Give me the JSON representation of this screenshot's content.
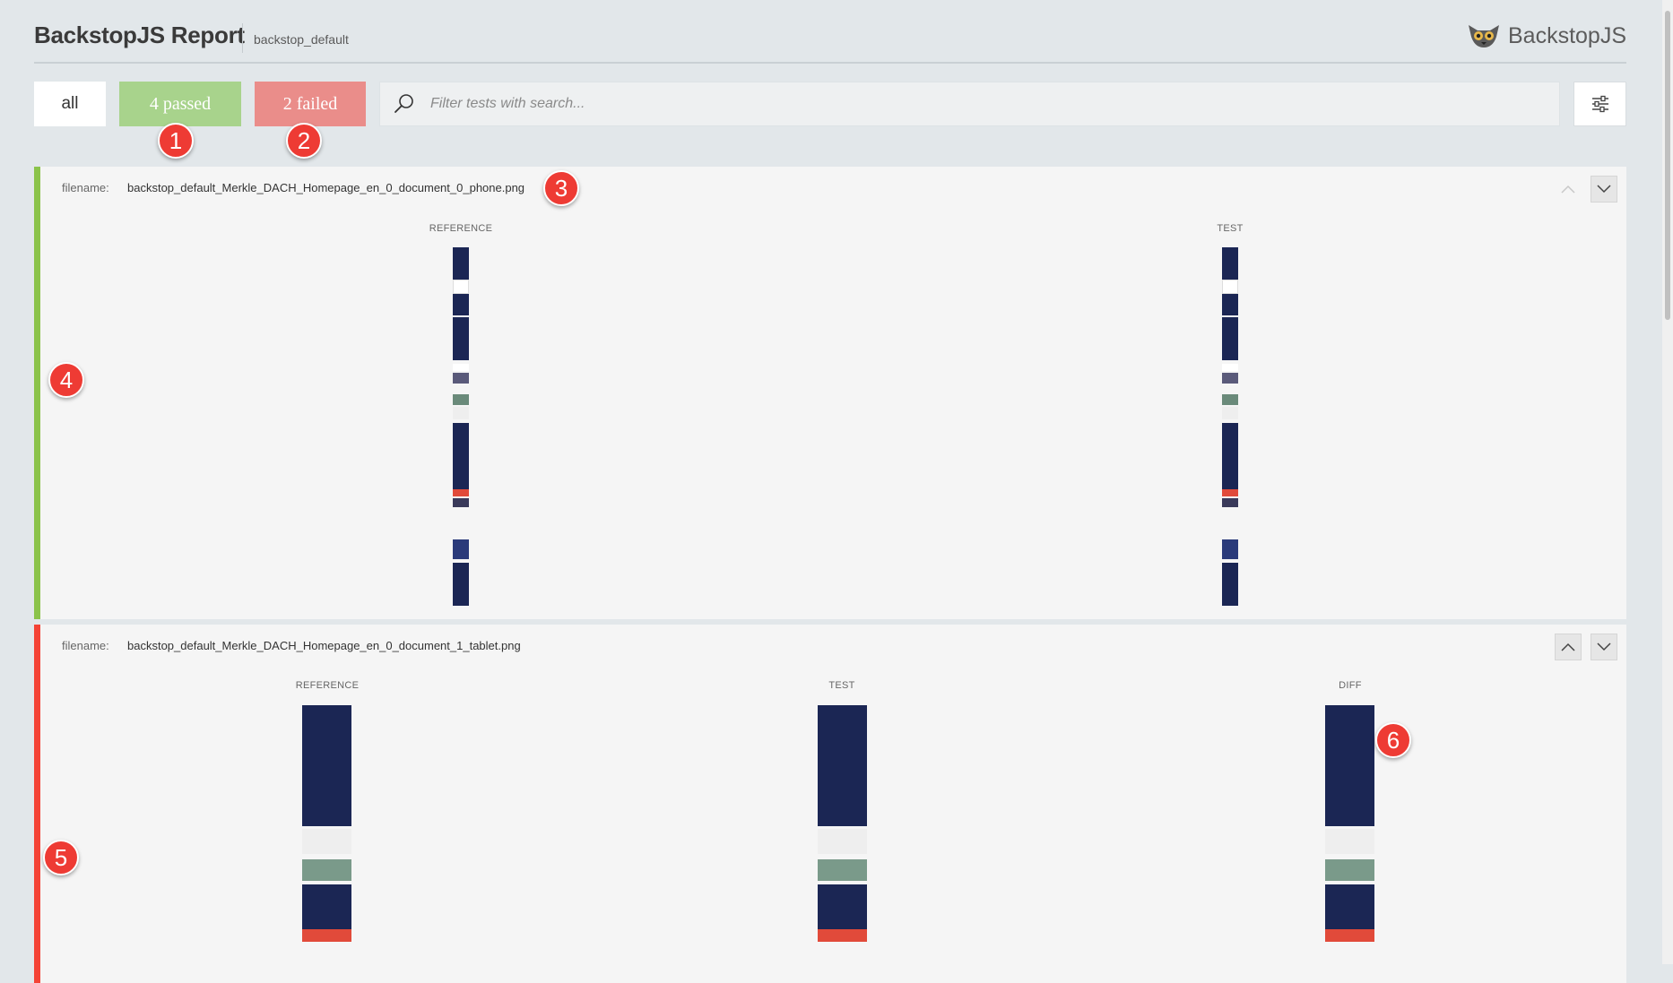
{
  "header": {
    "title": "BackstopJS Report",
    "subtitle": "backstop_default",
    "logo_text": "BackstopJS"
  },
  "filters": {
    "all_label": "all",
    "passed_label": "4 passed",
    "failed_label": "2 failed",
    "search_placeholder": "Filter tests with search..."
  },
  "tests": [
    {
      "status": "passed",
      "filename_label": "filename:",
      "filename": "backstop_default_Merkle_DACH_Homepage_en_0_document_0_phone.png",
      "columns": [
        "REFERENCE",
        "TEST"
      ]
    },
    {
      "status": "failed",
      "filename_label": "filename:",
      "filename": "backstop_default_Merkle_DACH_Homepage_en_0_document_1_tablet.png",
      "columns": [
        "REFERENCE",
        "TEST",
        "DIFF"
      ]
    }
  ],
  "markers": [
    "1",
    "2",
    "3",
    "4",
    "5",
    "6"
  ],
  "colors": {
    "passed": "#a8d38c",
    "failed": "#ea8d8a",
    "pass_border": "#8bc34a",
    "fail_border": "#f44336",
    "marker": "#ee3b34",
    "thumb_dark": "#1b2654"
  },
  "icons": {
    "logo": "lemur-icon",
    "search": "search-icon",
    "settings": "sliders-icon",
    "up": "chevron-up-icon",
    "down": "chevron-down-icon"
  }
}
